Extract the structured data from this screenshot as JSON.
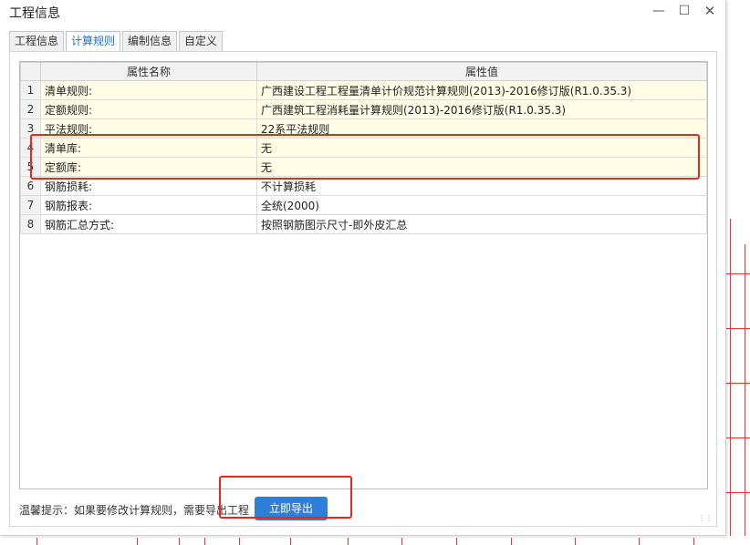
{
  "window": {
    "title": "工程信息",
    "minimize_icon": "minimize-icon",
    "maximize_icon": "maximize-icon",
    "close_icon": "close-icon"
  },
  "tabs": [
    {
      "label": "工程信息",
      "active": false
    },
    {
      "label": "计算规则",
      "active": true
    },
    {
      "label": "编制信息",
      "active": false
    },
    {
      "label": "自定义",
      "active": false
    }
  ],
  "table": {
    "headers": [
      "属性名称",
      "属性值"
    ],
    "rows": [
      {
        "index": "1",
        "name": "清单规则:",
        "value": "广西建设工程工程量清单计价规范计算规则(2013)-2016修订版(R1.0.35.3)",
        "highlight": true
      },
      {
        "index": "2",
        "name": "定额规则:",
        "value": "广西建筑工程消耗量计算规则(2013)-2016修订版(R1.0.35.3)",
        "highlight": true
      },
      {
        "index": "3",
        "name": "平法规则:",
        "value": "22系平法规则",
        "highlight": true
      },
      {
        "index": "4",
        "name": "清单库:",
        "value": "无",
        "highlight": true
      },
      {
        "index": "5",
        "name": "定额库:",
        "value": "无",
        "highlight": true
      },
      {
        "index": "6",
        "name": "钢筋损耗:",
        "value": "不计算损耗",
        "highlight": false
      },
      {
        "index": "7",
        "name": "钢筋报表:",
        "value": "全统(2000)",
        "highlight": false
      },
      {
        "index": "8",
        "name": "钢筋汇总方式:",
        "value": "按照钢筋图示尺寸-即外皮汇总",
        "highlight": false
      }
    ]
  },
  "footer": {
    "hint": "温馨提示：如果要修改计算规则，需要导出工程",
    "export_button": "立即导出"
  },
  "colors": {
    "accent": "#2f7fd6",
    "highlight_row": "#fffde6",
    "annotation": "#e8281e"
  }
}
